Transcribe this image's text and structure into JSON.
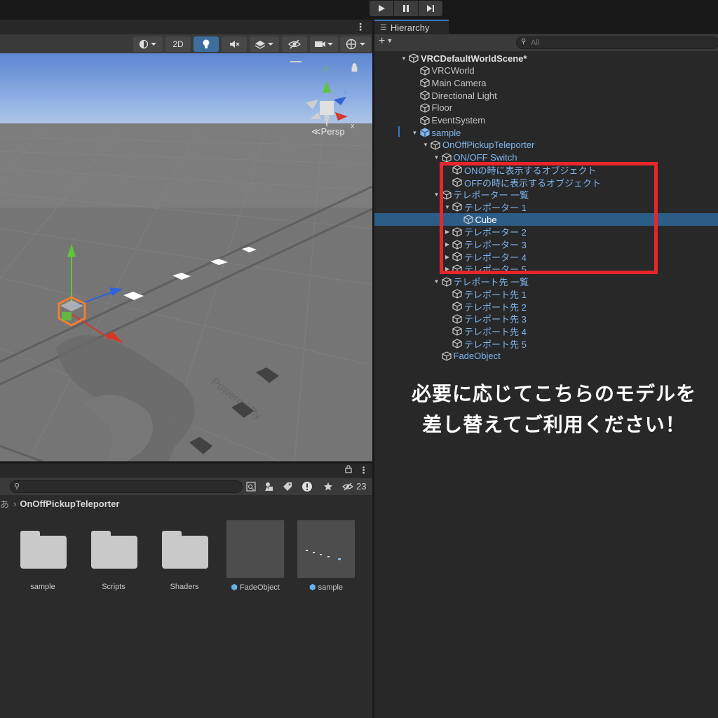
{
  "top_bar": {
    "play_icon": "play-icon",
    "pause_icon": "pause-icon",
    "step_icon": "step-icon"
  },
  "scene_view": {
    "toolbar": {
      "mode_2d": "2D"
    },
    "persp_label": "≪Persp",
    "gizmo_axes": {
      "y": "y",
      "z": "z",
      "x": "x"
    }
  },
  "project": {
    "count": "23",
    "breadcrumb": {
      "prefix": "あ",
      "current": "OnOffPickupTeleporter"
    },
    "assets": [
      {
        "label": "sample",
        "kind": "folder"
      },
      {
        "label": "Scripts",
        "kind": "folder"
      },
      {
        "label": "Shaders",
        "kind": "folder"
      },
      {
        "label": "FadeObject",
        "kind": "prefab"
      },
      {
        "label": "sample",
        "kind": "prefab"
      }
    ]
  },
  "hierarchy": {
    "tab_label": "Hierarchy",
    "search_placeholder": "All",
    "rows": [
      {
        "label": "VRCDefaultWorldScene*",
        "depth": 0,
        "arrow": "down",
        "style": "bold",
        "icon": "unity-scene-icon"
      },
      {
        "label": "VRCWorld",
        "depth": 1,
        "arrow": "",
        "style": "",
        "icon": "gameobject-icon"
      },
      {
        "label": "Main Camera",
        "depth": 1,
        "arrow": "",
        "style": "",
        "icon": "gameobject-icon"
      },
      {
        "label": "Directional Light",
        "depth": 1,
        "arrow": "",
        "style": "",
        "icon": "gameobject-icon"
      },
      {
        "label": "Floor",
        "depth": 1,
        "arrow": "",
        "style": "",
        "icon": "gameobject-icon"
      },
      {
        "label": "EventSystem",
        "depth": 1,
        "arrow": "",
        "style": "",
        "icon": "gameobject-icon"
      },
      {
        "label": "sample",
        "depth": 1,
        "arrow": "down",
        "style": "blue",
        "icon": "prefab-icon"
      },
      {
        "label": "OnOffPickupTeleporter",
        "depth": 2,
        "arrow": "down",
        "style": "blue",
        "icon": "gameobject-icon"
      },
      {
        "label": "ON/OFF Switch",
        "depth": 3,
        "arrow": "down",
        "style": "blue",
        "icon": "gameobject-icon"
      },
      {
        "label": "ONの時に表示するオブジェクト",
        "depth": 4,
        "arrow": "",
        "style": "blue",
        "icon": "gameobject-icon"
      },
      {
        "label": "OFFの時に表示するオブジェクト",
        "depth": 4,
        "arrow": "",
        "style": "blue",
        "icon": "gameobject-icon"
      },
      {
        "label": "テレポーター 一覧",
        "depth": 3,
        "arrow": "down",
        "style": "blue",
        "icon": "gameobject-icon"
      },
      {
        "label": "テレポーター 1",
        "depth": 4,
        "arrow": "down",
        "style": "blue",
        "icon": "gameobject-icon"
      },
      {
        "label": "Cube",
        "depth": 5,
        "arrow": "",
        "style": "white",
        "icon": "gameobject-icon",
        "selected": true
      },
      {
        "label": "テレポーター 2",
        "depth": 4,
        "arrow": "right",
        "style": "blue",
        "icon": "gameobject-icon"
      },
      {
        "label": "テレポーター 3",
        "depth": 4,
        "arrow": "right",
        "style": "blue",
        "icon": "gameobject-icon"
      },
      {
        "label": "テレポーター 4",
        "depth": 4,
        "arrow": "right",
        "style": "blue",
        "icon": "gameobject-icon"
      },
      {
        "label": "テレポーター 5",
        "depth": 4,
        "arrow": "right",
        "style": "blue",
        "icon": "gameobject-icon"
      },
      {
        "label": "テレポート先 一覧",
        "depth": 3,
        "arrow": "down",
        "style": "blue",
        "icon": "gameobject-icon"
      },
      {
        "label": "テレポート先 1",
        "depth": 4,
        "arrow": "",
        "style": "blue",
        "icon": "gameobject-icon"
      },
      {
        "label": "テレポート先 2",
        "depth": 4,
        "arrow": "",
        "style": "blue",
        "icon": "gameobject-icon"
      },
      {
        "label": "テレポート先 3",
        "depth": 4,
        "arrow": "",
        "style": "blue",
        "icon": "gameobject-icon"
      },
      {
        "label": "テレポート先 4",
        "depth": 4,
        "arrow": "",
        "style": "blue",
        "icon": "gameobject-icon"
      },
      {
        "label": "テレポート先 5",
        "depth": 4,
        "arrow": "",
        "style": "blue",
        "icon": "gameobject-icon"
      },
      {
        "label": "FadeObject",
        "depth": 3,
        "arrow": "",
        "style": "blue",
        "icon": "gameobject-icon"
      }
    ]
  },
  "annotation": {
    "line1": "必要に応じてこちらのモデルを",
    "line2": "差し替えてご利用ください！",
    "highlight_color": "#e8262a"
  },
  "colors": {
    "selection": "#2c5d87",
    "prefab_blue": "#7fb6ee",
    "accent": "#3a79bb"
  }
}
